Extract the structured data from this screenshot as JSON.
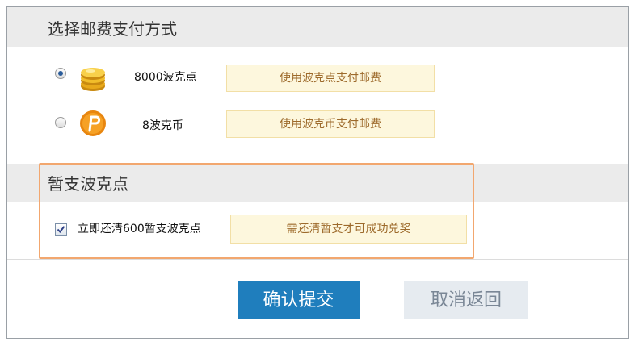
{
  "postage_section": {
    "title": "选择邮费支付方式",
    "options": [
      {
        "amount_label": "8000波克点",
        "pay_button": "使用波克点支付邮费",
        "selected": true,
        "icon": "gold-coins-icon"
      },
      {
        "amount_label": "8波克币",
        "pay_button": "使用波克币支付邮费",
        "selected": false,
        "icon": "poke-coin-icon"
      }
    ]
  },
  "advance_section": {
    "title": "暂支波克点",
    "checkbox_label": "立即还清600暂支波克点",
    "checked": true,
    "hint": "需还清暂支才可成功兑奖"
  },
  "actions": {
    "confirm_label": "确认提交",
    "cancel_label": "取消返回"
  },
  "colors": {
    "confirm_bg": "#1f7ebd",
    "highlight_border": "#f2a76f",
    "hint_text": "#9d6a2b"
  }
}
